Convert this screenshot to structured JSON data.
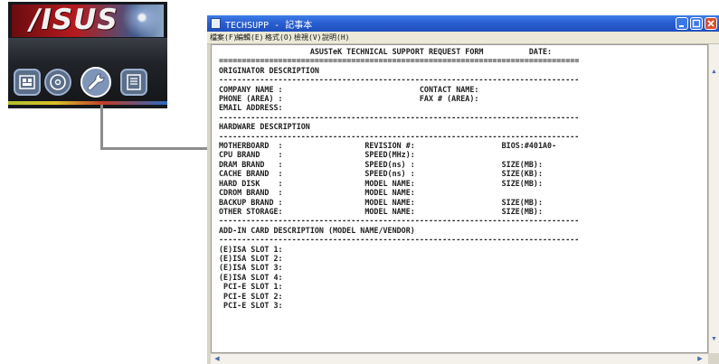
{
  "launcher": {
    "logo_text": "/ISUS",
    "buttons": [
      {
        "icon": "drivers-icon"
      },
      {
        "icon": "cd-icon"
      },
      {
        "icon": "wrench-icon",
        "active": true
      },
      {
        "icon": "document-icon"
      }
    ]
  },
  "window": {
    "title": "TECHSUPP - 記事本",
    "menu": [
      "檔案(F)",
      "編輯(E)",
      "格式(O)",
      "檢視(V)",
      "說明(H)"
    ],
    "controls": [
      "minimize-icon",
      "maximize-icon",
      "close-icon"
    ],
    "text_lines": [
      "                    ASUSTeK TECHNICAL SUPPORT REQUEST FORM          DATE:",
      "===============================================================================",
      "ORIGINATOR DESCRIPTION",
      "-------------------------------------------------------------------------------",
      "COMPANY NAME :                              CONTACT NAME:",
      "PHONE (AREA) :                              FAX # (AREA):",
      "EMAIL ADDRESS:",
      "-------------------------------------------------------------------------------",
      "HARDWARE DESCRIPTION",
      "-------------------------------------------------------------------------------",
      "MOTHERBOARD  :                  REVISION #:                   BIOS:#401A0-",
      "CPU BRAND    :                  SPEED(MHz):",
      "DRAM BRAND   :                  SPEED(ns) :                   SIZE(MB):",
      "CACHE BRAND  :                  SPEED(ns) :                   SIZE(KB):",
      "HARD DISK    :                  MODEL NAME:                   SIZE(MB):",
      "CDROM BRAND  :                  MODEL NAME:",
      "BACKUP BRAND :                  MODEL NAME:                   SIZE(MB):",
      "OTHER STORAGE:                  MODEL NAME:                   SIZE(MB):",
      "-------------------------------------------------------------------------------",
      "ADD-IN CARD DESCRIPTION (MODEL NAME/VENDOR)",
      "-------------------------------------------------------------------------------",
      "(E)ISA SLOT 1:",
      "(E)ISA SLOT 2:",
      "(E)ISA SLOT 3:",
      "(E)ISA SLOT 4:",
      " PCI-E SLOT 1:",
      " PCI-E SLOT 2:",
      " PCI-E SLOT 3:"
    ]
  },
  "colors": {
    "title_bar": "#2a5fd1",
    "menu_bg": "#ece9d8",
    "text": "#202020",
    "connector": "#8c8c8c"
  }
}
